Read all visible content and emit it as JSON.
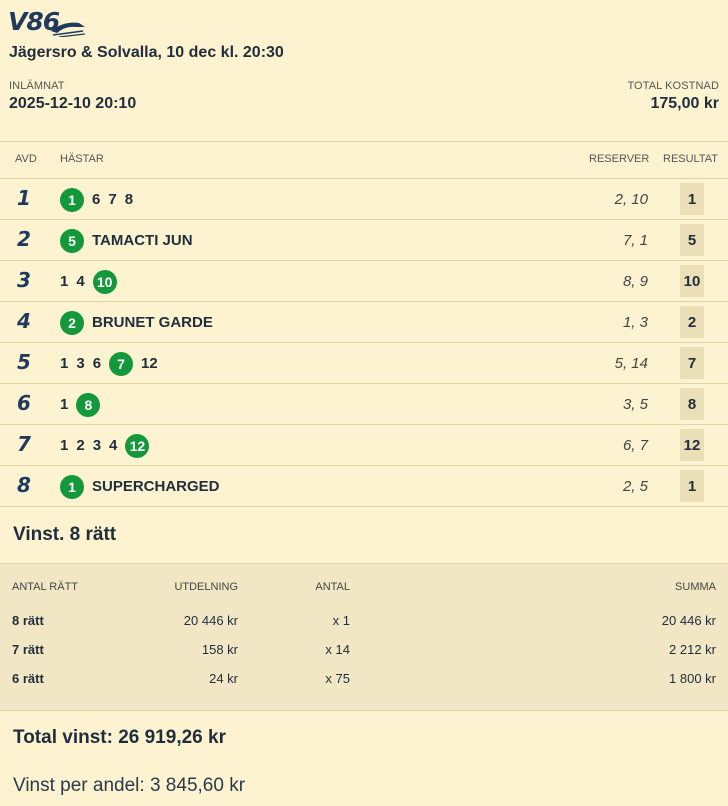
{
  "logo": {
    "text": "V86"
  },
  "race": {
    "title": "Jägersro & Solvalla, 10 dec kl. 20:30"
  },
  "meta": {
    "submitted_label": "INLÄMNAT",
    "submitted_value": "2025-12-10 20:10",
    "cost_label": "TOTAL KOSTNAD",
    "cost_value": "175,00 kr"
  },
  "table": {
    "headers": {
      "avd": "AVD",
      "horses": "HÄSTAR",
      "reserves": "RESERVER",
      "result": "RESULTAT"
    },
    "rows": [
      {
        "avd": "1",
        "horses": [
          {
            "n": "1",
            "win": true
          },
          {
            "n": "6"
          },
          {
            "n": "7"
          },
          {
            "n": "8"
          }
        ],
        "name": "",
        "reserves": "2, 10",
        "result": "1"
      },
      {
        "avd": "2",
        "horses": [
          {
            "n": "5",
            "win": true
          }
        ],
        "name": "TAMACTI JUN",
        "reserves": "7, 1",
        "result": "5"
      },
      {
        "avd": "3",
        "horses": [
          {
            "n": "1"
          },
          {
            "n": "4"
          },
          {
            "n": "10",
            "win": true
          }
        ],
        "name": "",
        "reserves": "8, 9",
        "result": "10"
      },
      {
        "avd": "4",
        "horses": [
          {
            "n": "2",
            "win": true
          }
        ],
        "name": "BRUNET GARDE",
        "reserves": "1, 3",
        "result": "2"
      },
      {
        "avd": "5",
        "horses": [
          {
            "n": "1"
          },
          {
            "n": "3"
          },
          {
            "n": "6"
          },
          {
            "n": "7",
            "win": true
          },
          {
            "n": "12"
          }
        ],
        "name": "",
        "reserves": "5, 14",
        "result": "7"
      },
      {
        "avd": "6",
        "horses": [
          {
            "n": "1"
          },
          {
            "n": "8",
            "win": true
          }
        ],
        "name": "",
        "reserves": "3, 5",
        "result": "8"
      },
      {
        "avd": "7",
        "horses": [
          {
            "n": "1"
          },
          {
            "n": "2"
          },
          {
            "n": "3"
          },
          {
            "n": "4"
          },
          {
            "n": "12",
            "win": true
          }
        ],
        "name": "",
        "reserves": "6, 7",
        "result": "12"
      },
      {
        "avd": "8",
        "horses": [
          {
            "n": "1",
            "win": true
          }
        ],
        "name": "SUPERCHARGED",
        "reserves": "2, 5",
        "result": "1"
      }
    ]
  },
  "winnings": {
    "title": "Vinst. 8 rätt",
    "headers": {
      "correct": "ANTAL RÄTT",
      "payout": "UTDELNING",
      "count": "ANTAL",
      "sum": "SUMMA"
    },
    "rows": [
      {
        "correct": "8 rätt",
        "payout": "20 446 kr",
        "count": "x 1",
        "sum": "20 446 kr"
      },
      {
        "correct": "7 rätt",
        "payout": "158 kr",
        "count": "x 14",
        "sum": "2 212 kr"
      },
      {
        "correct": "6 rätt",
        "payout": "24 kr",
        "count": "x 75",
        "sum": "1 800 kr"
      }
    ],
    "total": "Total vinst: 26 919,26 kr",
    "per_share": "Vinst per andel: 3 845,60 kr"
  },
  "colors": {
    "background": "#fdf3d0",
    "winner_green": "#13983b",
    "result_box": "#eadfb6",
    "brand_navy": "#1f3a5c"
  }
}
